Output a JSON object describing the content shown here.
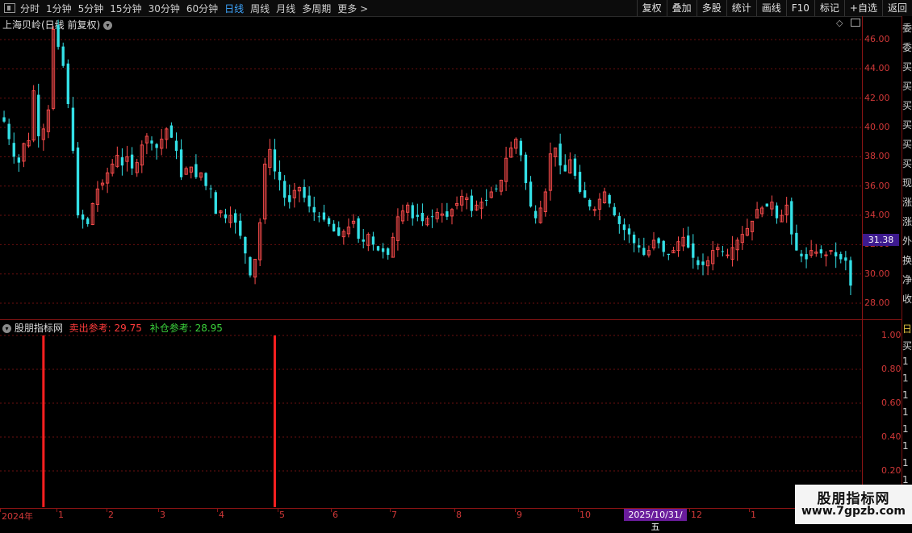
{
  "toolbar": {
    "periods": [
      "分时",
      "1分钟",
      "5分钟",
      "15分钟",
      "30分钟",
      "60分钟",
      "日线",
      "周线",
      "月线",
      "多周期",
      "更多 >"
    ],
    "active_period": "日线",
    "buttons": [
      "复权",
      "叠加",
      "多股",
      "统计",
      "画线",
      "F10",
      "标记",
      "+自选",
      "返回"
    ]
  },
  "main_panel": {
    "title": "上海贝岭(日线 前复权)"
  },
  "indicator_panel": {
    "name": "股朋指标网",
    "sell_label": "卖出参考: 29.75",
    "buy_label": "补仓参考: 28.95"
  },
  "price_axis": {
    "labels": [
      "46.00",
      "44.00",
      "42.00",
      "40.00",
      "38.00",
      "36.00",
      "34.00",
      "32.00",
      "30.00",
      "28.00"
    ],
    "current": "31.38"
  },
  "indicator_axis": {
    "labels": [
      "1.00",
      "0.80",
      "0.60",
      "0.40",
      "0.20"
    ]
  },
  "date_axis": {
    "labels": [
      "2024年",
      "1",
      "2",
      "3",
      "4",
      "5",
      "6",
      "7",
      "8",
      "9",
      "10",
      "12",
      "1"
    ],
    "cursor_date": "2025/10/31/五"
  },
  "side_panel": {
    "chars": [
      "委",
      "委",
      "买",
      "买",
      "买",
      "买",
      "买",
      "买",
      "现",
      "涨",
      "涨",
      "外",
      "换",
      "净",
      "收"
    ],
    "lower_chars": [
      "日",
      "买",
      "1",
      "1",
      "1",
      "1",
      "1",
      "1",
      "1",
      "1",
      "1"
    ]
  },
  "watermark": {
    "title": "股朋指标网",
    "url": "www.7gpzb.com"
  },
  "colors": {
    "up": "#ff4d4d",
    "down": "#33e0e6",
    "grid": "#6b0f0f",
    "signal": "#ff2020",
    "active_tab": "#3ea6ff"
  },
  "chart_data": {
    "type": "candlestick",
    "ylim": [
      26.9,
      47.6
    ],
    "close_series": [
      40.4,
      39.2,
      38.0,
      37.6,
      38.9,
      39.1,
      42.5,
      39.4,
      39.9,
      41.2,
      46.7,
      45.5,
      44.2,
      41.6,
      38.4,
      34.0,
      33.7,
      33.4,
      34.8,
      35.8,
      36.2,
      36.9,
      37.5,
      38.1,
      37.4,
      38.0,
      37.2,
      37.6,
      38.8,
      39.4,
      38.9,
      38.6,
      39.2,
      39.9,
      39.3,
      38.4,
      36.6,
      37.2,
      37.3,
      36.6,
      36.9,
      36.0,
      35.8,
      34.1,
      34.3,
      33.8,
      34.0,
      33.5,
      32.6,
      31.4,
      29.9,
      31.0,
      33.5,
      37.5,
      38.5,
      37.0,
      36.4,
      35.2,
      34.9,
      35.7,
      35.9,
      35.2,
      34.6,
      34.2,
      33.9,
      33.7,
      33.4,
      32.9,
      32.6,
      32.9,
      33.2,
      33.6,
      32.4,
      32.2,
      32.7,
      32.0,
      31.6,
      31.5,
      31.3,
      32.5,
      33.9,
      34.3,
      34.7,
      33.8,
      33.9,
      33.6,
      33.8,
      33.9,
      34.2,
      34.1,
      33.9,
      34.4,
      34.8,
      35.3,
      35.2,
      34.3,
      34.7,
      34.9,
      35.0,
      35.6,
      35.8,
      36.4,
      37.9,
      38.6,
      39.2,
      38.1,
      36.2,
      34.6,
      33.8,
      34.5,
      35.6,
      38.2,
      38.6,
      37.4,
      37.0,
      37.8,
      36.7,
      35.6,
      35.2,
      34.6,
      34.4,
      35.1,
      35.6,
      34.8,
      34.0,
      33.4,
      33.0,
      32.7,
      32.1,
      31.8,
      31.3,
      31.6,
      32.3,
      32.1,
      31.5,
      31.3,
      31.6,
      32.2,
      32.5,
      31.8,
      31.1,
      30.6,
      30.6,
      30.9,
      31.6,
      31.8,
      31.5,
      31.3,
      31.8,
      32.3,
      32.7,
      33.1,
      33.6,
      34.4,
      34.5,
      34.6,
      34.9,
      33.8,
      34.0,
      34.7,
      32.7,
      31.6,
      31.2,
      31.0,
      31.6,
      31.5,
      31.4,
      31.3,
      31.6,
      31.2,
      31.0,
      30.9,
      29.2
    ],
    "signal_bars": [
      {
        "index": 8,
        "value": 1.0
      },
      {
        "index": 55,
        "value": 1.0
      }
    ]
  }
}
